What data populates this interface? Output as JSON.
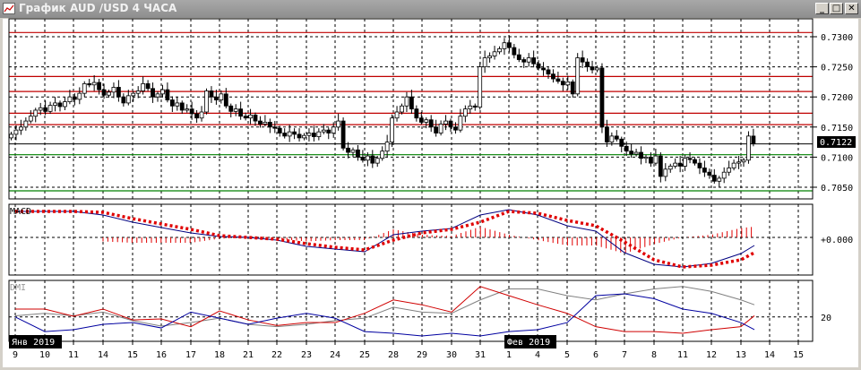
{
  "window": {
    "title": "График AUD /USD  4 ЧАСА",
    "minimize_icon": "minimize-icon",
    "maximize_icon": "maximize-icon",
    "close_icon": "close-icon"
  },
  "colors": {
    "grid": "#000000",
    "resistance": "#c00000",
    "support": "#008000",
    "current": "#000000",
    "macd": "#000080",
    "signal": "#e00000",
    "plus_di": "#0000a0",
    "minus_di": "#d00000",
    "adx": "#808080"
  },
  "price_axis": {
    "ticks": [
      "0.7300",
      "0.7250",
      "0.7200",
      "0.7150",
      "0.7100",
      "0.7050"
    ],
    "current_price": "0.7122"
  },
  "macd_panel": {
    "label": "MACD",
    "zero_label": "+0.000"
  },
  "dmi_panel": {
    "label": "DMI",
    "level_label": "20"
  },
  "date_axis": {
    "days": [
      "9",
      "10",
      "11",
      "14",
      "15",
      "16",
      "17",
      "18",
      "21",
      "22",
      "23",
      "24",
      "25",
      "28",
      "29",
      "30",
      "31",
      "1",
      "4",
      "5",
      "6",
      "7",
      "8",
      "11",
      "12",
      "13",
      "14",
      "15"
    ],
    "month_labels": [
      "Янв 2019",
      "Фев 2019"
    ]
  },
  "chart_data": {
    "type": "candlestick",
    "symbol": "AUD/USD",
    "timeframe": "4H",
    "ylim": [
      0.7035,
      0.732
    ],
    "horizontal_levels": {
      "resistance": [
        0.7307,
        0.7234,
        0.7209,
        0.7173,
        0.7154
      ],
      "current": 0.7122,
      "support": [
        0.7104,
        0.7044
      ]
    },
    "closes": [
      0.7138,
      0.7145,
      0.715,
      0.716,
      0.7168,
      0.7178,
      0.7182,
      0.7176,
      0.7186,
      0.719,
      0.7184,
      0.7192,
      0.72,
      0.7196,
      0.7206,
      0.7222,
      0.722,
      0.7224,
      0.7212,
      0.7203,
      0.7208,
      0.7216,
      0.72,
      0.719,
      0.7202,
      0.7206,
      0.721,
      0.7222,
      0.7214,
      0.72,
      0.7205,
      0.7212,
      0.7195,
      0.7185,
      0.719,
      0.7178,
      0.718,
      0.7172,
      0.7165,
      0.7175,
      0.721,
      0.72,
      0.7195,
      0.7205,
      0.7185,
      0.7176,
      0.718,
      0.7168,
      0.7165,
      0.717,
      0.716,
      0.7155,
      0.7158,
      0.715,
      0.7148,
      0.714,
      0.7135,
      0.7142,
      0.7138,
      0.7132,
      0.7136,
      0.714,
      0.7134,
      0.7142,
      0.7145,
      0.714,
      0.715,
      0.716,
      0.7115,
      0.7108,
      0.7112,
      0.71,
      0.7095,
      0.7102,
      0.709,
      0.7098,
      0.711,
      0.7125,
      0.7165,
      0.7175,
      0.7185,
      0.72,
      0.718,
      0.7165,
      0.7158,
      0.7162,
      0.715,
      0.714,
      0.7155,
      0.716,
      0.715,
      0.7145,
      0.7168,
      0.718,
      0.7185,
      0.7183,
      0.725,
      0.7265,
      0.7268,
      0.7275,
      0.728,
      0.729,
      0.7282,
      0.727,
      0.7262,
      0.7258,
      0.7265,
      0.7255,
      0.7248,
      0.7245,
      0.7238,
      0.723,
      0.7226,
      0.722,
      0.7225,
      0.7205,
      0.7265,
      0.7258,
      0.725,
      0.7245,
      0.7248,
      0.715,
      0.7125,
      0.7135,
      0.713,
      0.7118,
      0.711,
      0.7105,
      0.7108,
      0.7098,
      0.71,
      0.709,
      0.7102,
      0.7068,
      0.708,
      0.7085,
      0.709,
      0.7085,
      0.7098,
      0.7096,
      0.709,
      0.7082,
      0.7075,
      0.707,
      0.706,
      0.7065,
      0.7075,
      0.7082,
      0.709,
      0.7092,
      0.7095,
      0.7135,
      0.7122
    ],
    "indicator_dates": [
      "Jan 9",
      "Jan 10",
      "Jan 11",
      "Jan 14",
      "Jan 15",
      "Jan 16",
      "Jan 17",
      "Jan 18",
      "Jan 21",
      "Jan 22",
      "Jan 23",
      "Jan 24",
      "Jan 25",
      "Jan 28",
      "Jan 29",
      "Jan 30",
      "Jan 31",
      "Feb 1",
      "Feb 4",
      "Feb 5",
      "Feb 6",
      "Feb 7",
      "Feb 8",
      "Feb 11",
      "Feb 12",
      "Feb 13",
      "last"
    ],
    "macd": {
      "ylim": [
        -0.0042,
        0.0037
      ],
      "macd": [
        0.0029,
        0.0029,
        0.0029,
        0.0025,
        0.0017,
        0.0011,
        0.0005,
        0.0001,
        0,
        -0.0003,
        -0.001,
        -0.0013,
        -0.0016,
        0.0003,
        0.0007,
        0.001,
        0.0025,
        0.0031,
        0.0025,
        0.0013,
        0.0007,
        -0.0017,
        -0.003,
        -0.0033,
        -0.0029,
        -0.0018,
        -0.0009
      ],
      "signal": [
        0.0029,
        0.0029,
        0.0029,
        0.0028,
        0.0021,
        0.0015,
        0.0009,
        0.0002,
        0,
        -0.0002,
        -0.0007,
        -0.0011,
        -0.0014,
        -0.0003,
        0.0005,
        0.0009,
        0.0017,
        0.0029,
        0.0027,
        0.0019,
        0.0013,
        -0.0005,
        -0.0025,
        -0.0033,
        -0.0031,
        -0.0025,
        -0.0017
      ]
    },
    "dmi": {
      "ylim": [
        0,
        50
      ],
      "level": 20,
      "plus_di": [
        20,
        8,
        9.6,
        14,
        15.4,
        11,
        24,
        19,
        14,
        19,
        23,
        19,
        8,
        6.6,
        4.4,
        6.6,
        4.4,
        8,
        9.6,
        15.4,
        37.5,
        39,
        35,
        26.5,
        23,
        15.4,
        9.6
      ],
      "minus_di": [
        26.5,
        26.5,
        20.6,
        26.5,
        17.6,
        18.4,
        12,
        25,
        17.6,
        13,
        15.4,
        15.4,
        23,
        34,
        30,
        24,
        45,
        37.5,
        30,
        23,
        12,
        8,
        8,
        6.6,
        9.6,
        12,
        21
      ],
      "adx": [
        21,
        23,
        21,
        24,
        17,
        12.5,
        15.4,
        19,
        14,
        12,
        14,
        17,
        19,
        28,
        24,
        23,
        34,
        43,
        43,
        37.5,
        34,
        39,
        43,
        45,
        41,
        34,
        30
      ]
    }
  }
}
